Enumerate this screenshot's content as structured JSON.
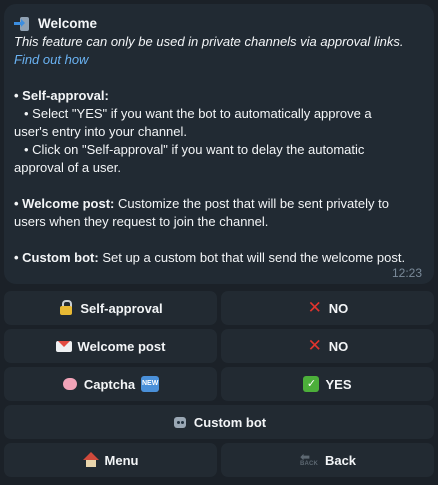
{
  "message": {
    "title": "Welcome",
    "intro": "This feature can only be used in private channels via approval links.",
    "link": "Find out how",
    "self_approval_heading": "• Self-approval:",
    "self_approval_line1": "• Select \"YES\" if you want the bot to automatically approve a",
    "self_approval_line1b": "user's entry into your channel.",
    "self_approval_line2": "• Click on \"Self-approval\" if you want to delay the automatic",
    "self_approval_line2b": "approval of a user.",
    "welcome_post_label": "• Welcome post:",
    "welcome_post_text": " Customize the post that will be sent privately to",
    "welcome_post_text2": "users when they request to join the channel.",
    "custom_bot_label": "• Custom bot:",
    "custom_bot_text": " Set up a custom bot that will send the welcome post.",
    "time": "12:23"
  },
  "keyboard": {
    "self_approval": "Self-approval",
    "self_approval_state": "NO",
    "welcome_post": "Welcome post",
    "welcome_post_state": "NO",
    "captcha": "Captcha",
    "captcha_badge": "NEW",
    "captcha_state": "YES",
    "custom_bot": "Custom bot",
    "menu": "Menu",
    "back": "Back",
    "back_icon_word": "BACK"
  },
  "icons": {
    "title": "phone-with-arrow-icon",
    "self_approval": "lock-icon",
    "no": "cross-mark-icon",
    "yes": "check-mark-icon",
    "welcome_post": "envelope-icon",
    "captcha": "brain-icon",
    "new": "new-badge-icon",
    "custom_bot": "robot-icon",
    "menu": "house-icon",
    "back": "back-arrow-icon"
  },
  "colors": {
    "link": "#6ab2f2",
    "bubble": "#212a33",
    "button": "#222a32",
    "cross": "#e0342d",
    "check": "#4caf3a"
  }
}
